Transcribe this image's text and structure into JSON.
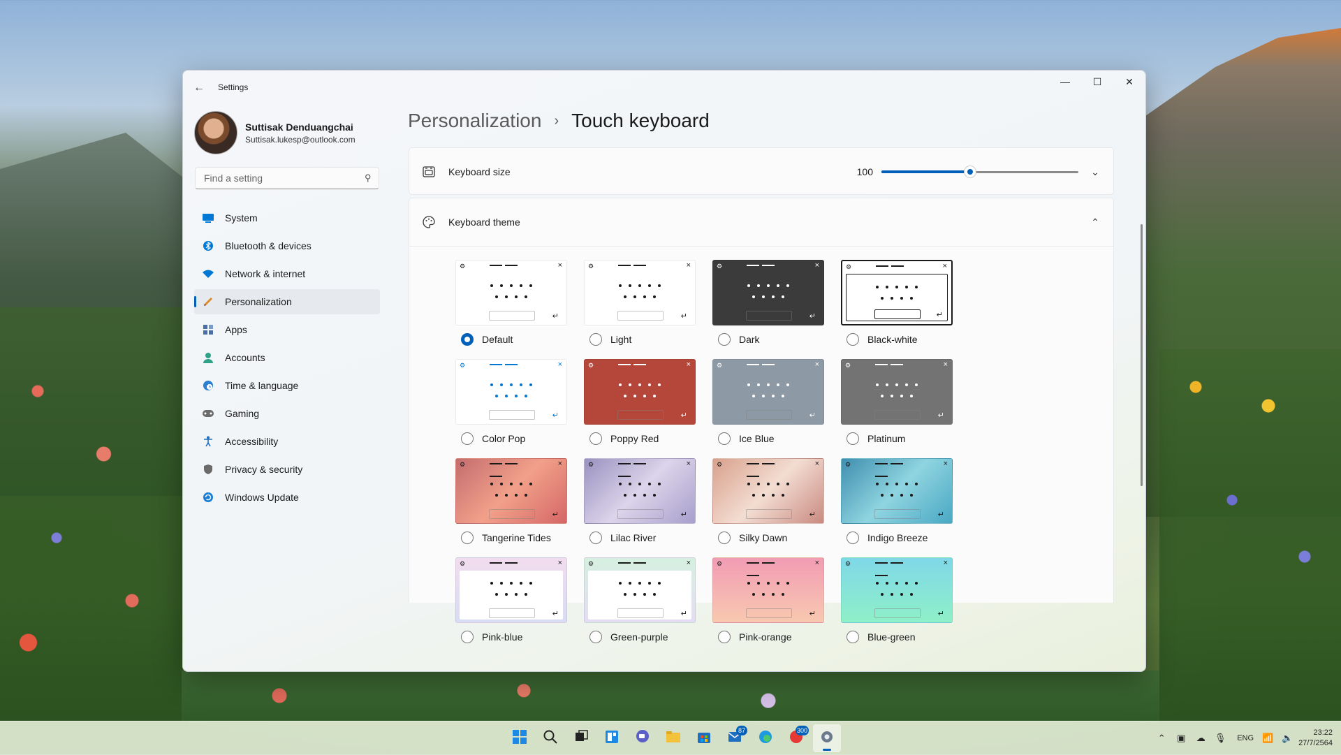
{
  "window": {
    "title": "Settings",
    "controls": {
      "minimize": "—",
      "maximize": "☐",
      "close": "✕"
    }
  },
  "profile": {
    "name": "Suttisak Denduangchai",
    "email": "Suttisak.lukesp@outlook.com"
  },
  "search": {
    "placeholder": "Find a setting",
    "value": ""
  },
  "nav": {
    "items": [
      {
        "label": "System",
        "icon": "system-icon",
        "color": "#0078d4"
      },
      {
        "label": "Bluetooth & devices",
        "icon": "bluetooth-icon",
        "color": "#0078d4"
      },
      {
        "label": "Network & internet",
        "icon": "wifi-icon",
        "color": "#0078d4"
      },
      {
        "label": "Personalization",
        "icon": "brush-icon",
        "color": "#e08a2e",
        "active": true
      },
      {
        "label": "Apps",
        "icon": "apps-icon",
        "color": "#4a6fa5"
      },
      {
        "label": "Accounts",
        "icon": "person-icon",
        "color": "#2fa38a"
      },
      {
        "label": "Time & language",
        "icon": "globe-clock-icon",
        "color": "#2a7fd0"
      },
      {
        "label": "Gaming",
        "icon": "gamepad-icon",
        "color": "#6b6b6b"
      },
      {
        "label": "Accessibility",
        "icon": "accessibility-icon",
        "color": "#1e6fc0"
      },
      {
        "label": "Privacy & security",
        "icon": "shield-icon",
        "color": "#6b6b6b"
      },
      {
        "label": "Windows Update",
        "icon": "update-icon",
        "color": "#1a7fd4"
      }
    ]
  },
  "breadcrumb": {
    "parent": "Personalization",
    "separator": "›",
    "current": "Touch keyboard"
  },
  "keyboard_size": {
    "label": "Keyboard size",
    "value": "100",
    "slider_fraction": 0.45
  },
  "keyboard_theme": {
    "label": "Keyboard theme",
    "selected": "Default",
    "themes": [
      {
        "name": "Default",
        "bg": "#ffffff",
        "top": "#eef0f3",
        "key": "#ffffff",
        "dot": "#1a1a1a",
        "border": "none"
      },
      {
        "name": "Light",
        "bg": "#ffffff",
        "top": "#eef0f3",
        "key": "#ffffff",
        "dot": "#1a1a1a",
        "border": "none"
      },
      {
        "name": "Dark",
        "bg": "#3b3b3b",
        "top": "#1f1f1f",
        "key": "#3b3b3b",
        "dot": "#ffffff",
        "border": "none"
      },
      {
        "name": "Black-white",
        "bg": "#ffffff",
        "top": "#ffffff",
        "key": "#ffffff",
        "dot": "#1a1a1a",
        "border": "#1a1a1a"
      },
      {
        "name": "Color Pop",
        "bg": "#ffffff",
        "top": "#eef3f8",
        "key": "#ffffff",
        "dot": "#0078d4",
        "border": "none"
      },
      {
        "name": "Poppy Red",
        "bg": "#b5473a",
        "top": "#a03b2f",
        "key": "#b5473a",
        "dot": "#ffffff",
        "border": "none"
      },
      {
        "name": "Ice Blue",
        "bg": "#8d99a4",
        "top": "#7f8b96",
        "key": "#8d99a4",
        "dot": "#ffffff",
        "border": "none"
      },
      {
        "name": "Platinum",
        "bg": "#737373",
        "top": "#666666",
        "key": "#737373",
        "dot": "#ffffff",
        "border": "none"
      },
      {
        "name": "Tangerine Tides",
        "bg": "linear-gradient(135deg,#c46d6f,#f2a08a 50%,#d46767)",
        "top": "transparent",
        "key": "transparent",
        "dot": "#1a1a1a",
        "border": "none"
      },
      {
        "name": "Lilac River",
        "bg": "linear-gradient(135deg,#9a92c0,#dcd4ea 50%,#a89fcc)",
        "top": "transparent",
        "key": "transparent",
        "dot": "#1a1a1a",
        "border": "none"
      },
      {
        "name": "Silky Dawn",
        "bg": "linear-gradient(135deg,#d8a08c,#f3ddd2 50%,#c98a80)",
        "top": "transparent",
        "key": "transparent",
        "dot": "#1a1a1a",
        "border": "none"
      },
      {
        "name": "Indigo Breeze",
        "bg": "linear-gradient(135deg,#3f8fb0,#8fd4e0 50%,#4aa8c4)",
        "top": "transparent",
        "key": "transparent",
        "dot": "#1a1a1a",
        "border": "none"
      },
      {
        "name": "Pink-blue",
        "bg": "linear-gradient(180deg,#f1dcee,#d8dcf4)",
        "top": "transparent",
        "key": "#ffffff",
        "dot": "#1a1a1a",
        "border": "none"
      },
      {
        "name": "Green-purple",
        "bg": "linear-gradient(180deg,#d6f0e0,#e4dcf2)",
        "top": "transparent",
        "key": "#ffffff",
        "dot": "#1a1a1a",
        "border": "none"
      },
      {
        "name": "Pink-orange",
        "bg": "linear-gradient(180deg,#f29cb4,#f8c8b0)",
        "top": "transparent",
        "key": "transparent",
        "dot": "#1a1a1a",
        "border": "none"
      },
      {
        "name": "Blue-green",
        "bg": "linear-gradient(180deg,#7fd8e8,#8ef0c8)",
        "top": "transparent",
        "key": "transparent",
        "dot": "#1a1a1a",
        "border": "none"
      }
    ]
  },
  "taskbar": {
    "apps": [
      {
        "icon": "start-icon"
      },
      {
        "icon": "search-icon"
      },
      {
        "icon": "task-view-icon"
      },
      {
        "icon": "widgets-icon"
      },
      {
        "icon": "chat-icon"
      },
      {
        "icon": "file-explorer-icon"
      },
      {
        "icon": "store-icon"
      },
      {
        "icon": "mail-icon",
        "badge": "87"
      },
      {
        "icon": "edge-icon"
      },
      {
        "icon": "app-300-icon",
        "badge": "300"
      },
      {
        "icon": "settings-icon",
        "active": true
      }
    ],
    "tray": {
      "language": "ENG",
      "time": "23:22",
      "date": "27/7/2564"
    }
  },
  "colors": {
    "accent": "#005fb8"
  }
}
